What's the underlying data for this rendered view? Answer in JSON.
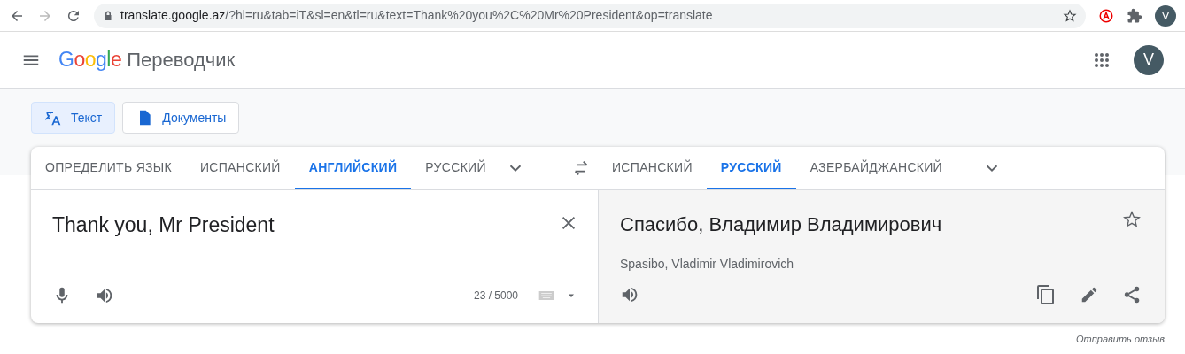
{
  "browser": {
    "url_host": "translate.google.az",
    "url_path": "/?hl=ru&tab=iT&sl=en&tl=ru&text=Thank%20you%2C%20Mr%20President&op=translate",
    "profile": "V"
  },
  "header": {
    "logo": "Google",
    "title": "Переводчик",
    "avatar": "V"
  },
  "modes": [
    {
      "label": "Текст",
      "kind": "text",
      "selected": true
    },
    {
      "label": "Документы",
      "kind": "document",
      "selected": false
    }
  ],
  "source_languages": [
    {
      "label": "ОПРЕДЕЛИТЬ ЯЗЫК",
      "selected": false
    },
    {
      "label": "ИСПАНСКИЙ",
      "selected": false
    },
    {
      "label": "АНГЛИЙСКИЙ",
      "selected": true
    },
    {
      "label": "РУССКИЙ",
      "selected": false
    }
  ],
  "target_languages": [
    {
      "label": "ИСПАНСКИЙ",
      "selected": false
    },
    {
      "label": "РУССКИЙ",
      "selected": true
    },
    {
      "label": "АЗЕРБАЙДЖАНСКИЙ",
      "selected": false
    }
  ],
  "source": {
    "text": "Thank you, Mr President",
    "counter": "23 / 5000"
  },
  "target": {
    "text": "Спасибо, Владимир Владимирович",
    "transliteration": "Spasibo, Vladimir Vladimirovich"
  },
  "feedback": "Отправить отзыв"
}
